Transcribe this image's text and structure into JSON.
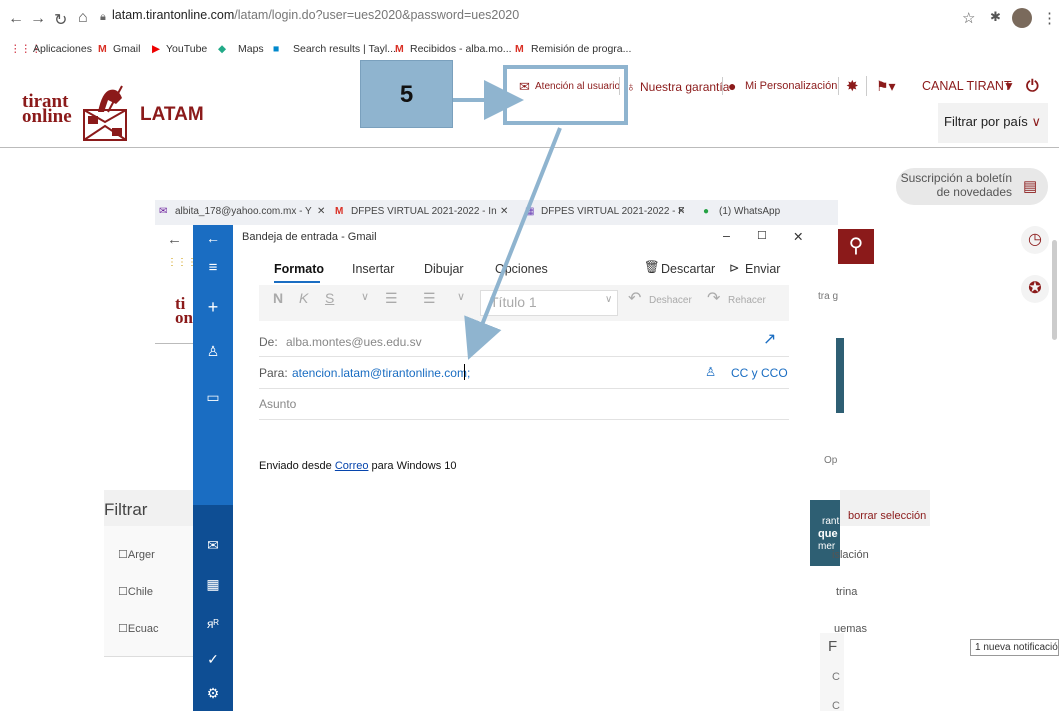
{
  "browser": {
    "url_domain": "latam.tirantonline.com",
    "url_path": "/latam/login.do?user=ues2020&password=ues2020",
    "bookmarks": [
      "Aplicaciones",
      "Gmail",
      "YouTube",
      "Maps",
      "Search results | Tayl...",
      "Recibidos - alba.mo...",
      "Remisión de progra..."
    ]
  },
  "site": {
    "logo_line1": "tirant",
    "logo_line2": "online",
    "logo_region": "LATAM",
    "nav_atencion": "Atención al usuario",
    "nav_garantia": "Nuestra garantía",
    "nav_personal": "Mi Personalización",
    "nav_canal": "CANAL TIRANT",
    "filter_country": "Filtrar por país",
    "subscription_line1": "Suscripción a boletín",
    "subscription_line2": "de novedades",
    "filter_title": "Filtrar",
    "countries": [
      "Arger",
      "Chile",
      "Ecuac"
    ],
    "right_frag": [
      "tra g",
      "Op",
      "borrar selección",
      "islación",
      "trina",
      "uemas",
      "F",
      "rant",
      "que",
      "mer",
      "C",
      "C"
    ],
    "bg_logo1": "ti",
    "bg_logo2": "on"
  },
  "bg_tabs": [
    "albita_178@yahoo.com.mx - Y",
    "DFPES VIRTUAL 2021-2022 - In",
    "DFPES VIRTUAL 2021-2022 - F",
    "(1) WhatsApp"
  ],
  "callout": {
    "step": "5"
  },
  "mail": {
    "window_title": "Bandeja de entrada - Gmail",
    "tabs": [
      "Formato",
      "Insertar",
      "Dibujar",
      "Opciones"
    ],
    "discard": "Descartar",
    "send": "Enviar",
    "heading_style": "Título 1",
    "undo": "Deshacer",
    "redo": "Rehacer",
    "from_label": "De:",
    "from_value": "alba.montes@ues.edu.sv",
    "to_label": "Para:",
    "to_value": "atencion.latam@tirantonline.com;",
    "cc": "CC y CCO",
    "subject_placeholder": "Asunto",
    "signature_prefix": "Enviado desde",
    "signature_link": "Correo",
    "signature_suffix": "para Windows 10"
  },
  "notification": "1 nueva notificación",
  "colors": {
    "brand": "#8b1a1a",
    "mail_sidebar": "#1a6dc2",
    "callout": "#8fb4cf"
  }
}
